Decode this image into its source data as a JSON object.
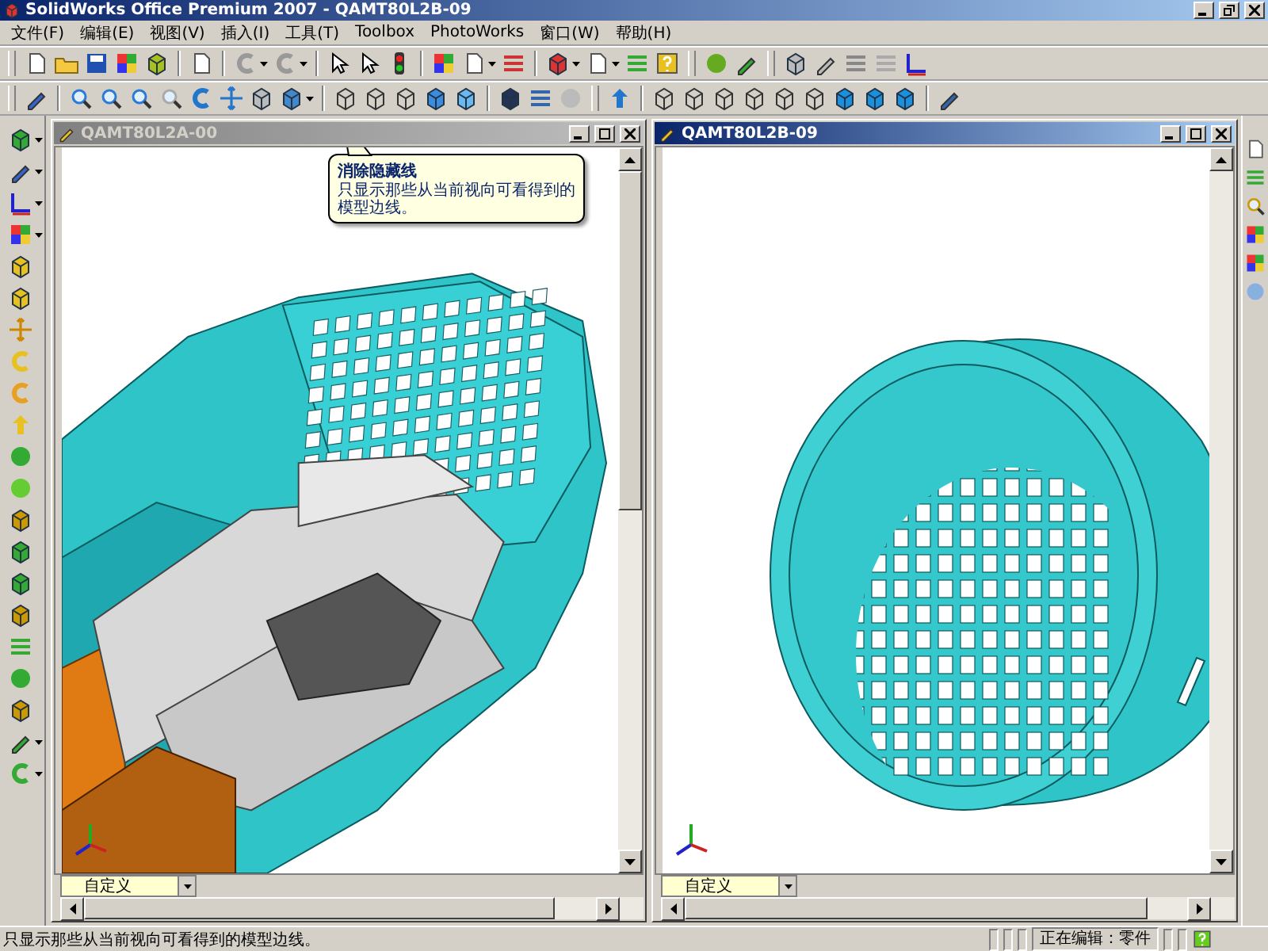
{
  "window": {
    "title": "SolidWorks Office Premium 2007 - QAMT80L2B-09"
  },
  "menu": [
    "文件(F)",
    "编辑(E)",
    "视图(V)",
    "插入(I)",
    "工具(T)",
    "Toolbox",
    "PhotoWorks",
    "窗口(W)",
    "帮助(H)"
  ],
  "documents": [
    {
      "title": "QAMT80L2A-00",
      "active": false,
      "view": "自定义",
      "kind": "cutaway"
    },
    {
      "title": "QAMT80L2B-09",
      "active": true,
      "view": "自定义",
      "kind": "cover"
    }
  ],
  "tooltip": {
    "title": "消除隐藏线",
    "text": "只显示那些从当前视向可看得到的模型边线。"
  },
  "status_bar": {
    "message": "只显示那些从当前视向可看得到的模型边线。",
    "editing": "正在编辑：零件"
  }
}
